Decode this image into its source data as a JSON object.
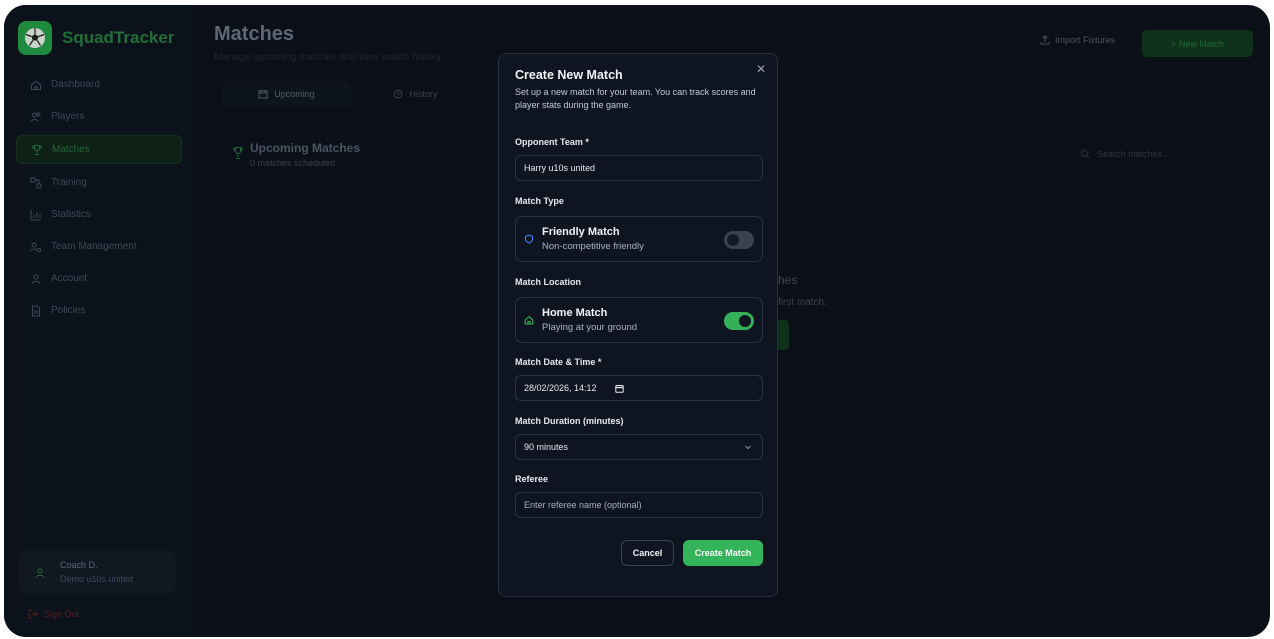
{
  "app": {
    "name": "SquadTracker"
  },
  "sidebar": {
    "items": [
      {
        "label": "Dashboard",
        "icon": "home-icon"
      },
      {
        "label": "Players",
        "icon": "users-icon"
      },
      {
        "label": "Matches",
        "icon": "trophy-icon",
        "active": true
      },
      {
        "label": "Training",
        "icon": "drill-icon"
      },
      {
        "label": "Statistics",
        "icon": "bar-chart-icon"
      },
      {
        "label": "Team Management",
        "icon": "team-settings-icon"
      },
      {
        "label": "Account",
        "icon": "user-icon"
      },
      {
        "label": "Policies",
        "icon": "document-icon"
      }
    ],
    "user": {
      "name": "Coach D.",
      "team": "Demo u10s united"
    },
    "signout_label": "Sign Out"
  },
  "header": {
    "title": "Matches",
    "subtitle": "Manage upcoming matches and view match history",
    "import_label": "Import Fixtures",
    "new_match_label": "+ New Match"
  },
  "tabs": [
    {
      "label": "Upcoming",
      "active": true
    },
    {
      "label": "History"
    }
  ],
  "section": {
    "title": "Upcoming Matches",
    "subtitle": "0 matches scheduled",
    "search_placeholder": "Search matches..."
  },
  "empty_state": {
    "title_fragment": "hes",
    "subtitle_fragment": "first match."
  },
  "modal": {
    "title": "Create New Match",
    "description": "Set up a new match for your team. You can track scores and player stats during the game.",
    "close_icon": "close-icon",
    "opponent": {
      "label": "Opponent Team *",
      "value": "Harry u10s united"
    },
    "match_type": {
      "label": "Match Type",
      "title": "Friendly Match",
      "subtitle": "Non-competitive friendly",
      "enabled": false
    },
    "location": {
      "label": "Match Location",
      "title": "Home Match",
      "subtitle": "Playing at your ground",
      "enabled": true
    },
    "datetime": {
      "label": "Match Date & Time *",
      "value": "28/02/2026, 14:12"
    },
    "duration": {
      "label": "Match Duration (minutes)",
      "value": "90 minutes"
    },
    "referee": {
      "label": "Referee",
      "placeholder": "Enter referee name (optional)"
    },
    "cancel_label": "Cancel",
    "create_label": "Create Match"
  },
  "colors": {
    "accent": "#33b35a",
    "modal_bg": "#0f1520",
    "toggle_off": "#3a4250",
    "friendly_icon": "#3b82f6"
  }
}
